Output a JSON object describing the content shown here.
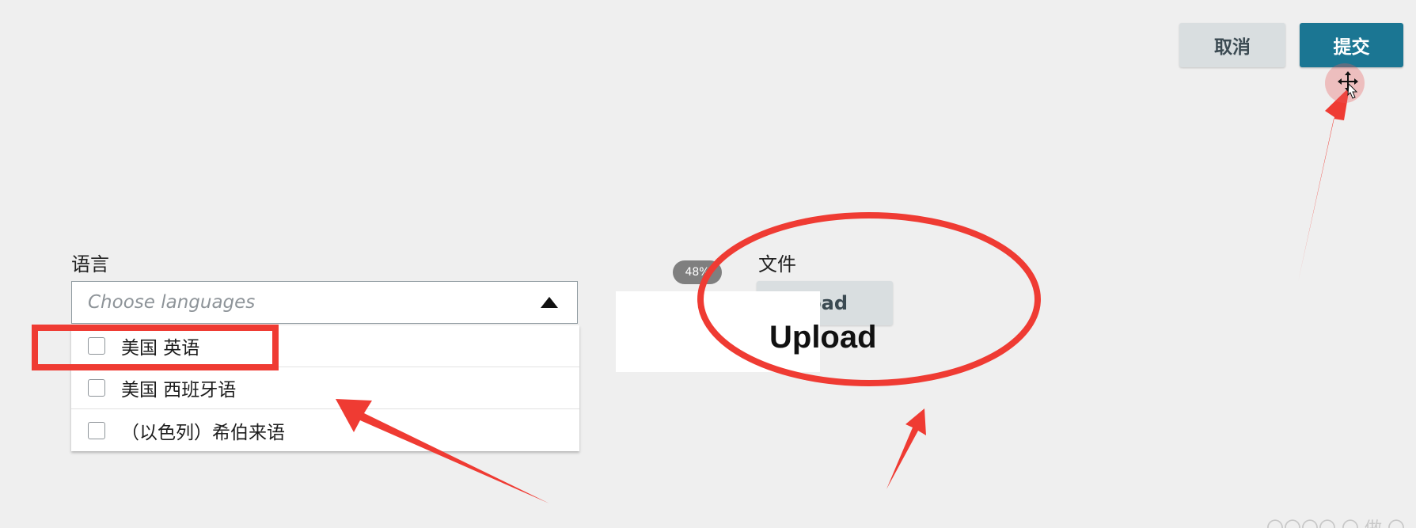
{
  "header": {
    "cancel_label": "取消",
    "submit_label": "提交"
  },
  "language": {
    "label": "语言",
    "placeholder": "Choose languages",
    "options": [
      "美国 英语",
      "美国 西班牙语",
      "（以色列）希伯来语"
    ]
  },
  "file": {
    "label": "文件",
    "upload_button_label": "load",
    "upload_overlay_text": "Upload",
    "progress_badge": "48%"
  },
  "colors": {
    "submit_bg": "#1b7693",
    "annotation_red": "#ef3b33",
    "cancel_bg": "#d9dee0"
  },
  "icons": {
    "caret": "triangle-up-icon",
    "cursor": "move-cursor-icon"
  },
  "watermark": "〇〇〇〇 〇 做 〇"
}
